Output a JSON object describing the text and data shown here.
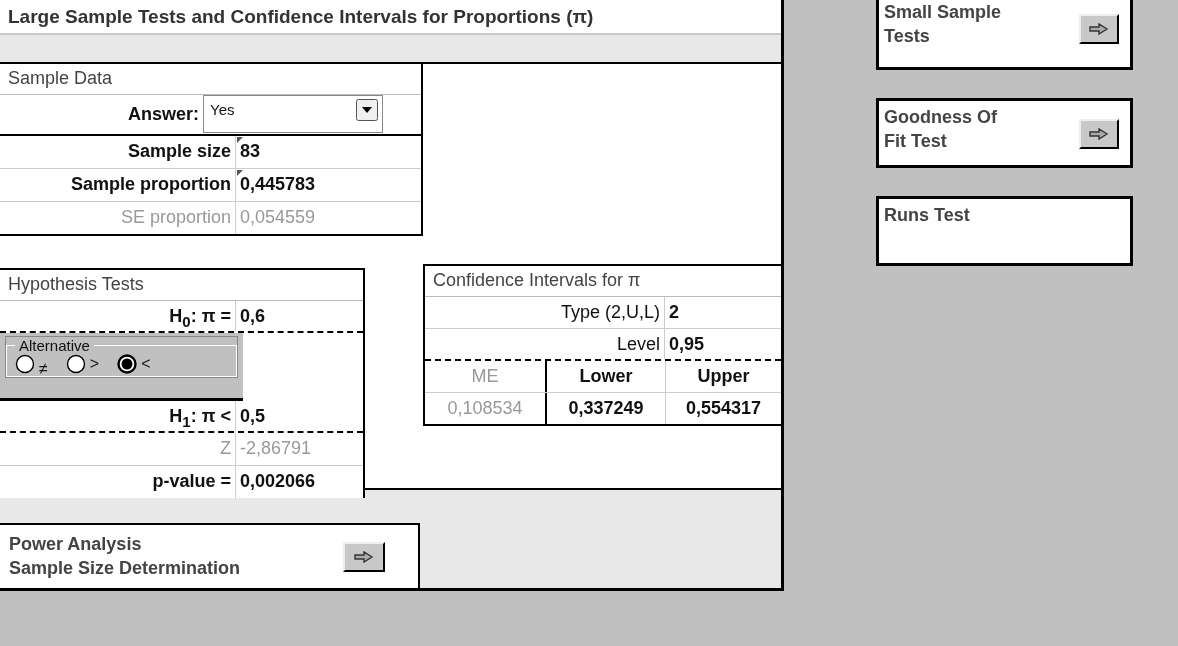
{
  "title": "Large Sample Tests and Confidence Intervals for Proportions (π)",
  "sample_data": {
    "heading": "Sample Data",
    "answer": {
      "label": "Answer:",
      "value": "Yes"
    },
    "rows": [
      {
        "label": "Sample size",
        "value": "83",
        "kind": "input"
      },
      {
        "label": "Sample proportion",
        "value": "0,445783",
        "kind": "input"
      },
      {
        "label": "SE proportion",
        "value": "0,054559",
        "kind": "computed"
      }
    ]
  },
  "hypothesis": {
    "heading": "Hypothesis Tests",
    "h0": {
      "label": "H$_{0}$: π =",
      "value": "0,6"
    },
    "alternative": {
      "legend": "Alternative",
      "options": [
        {
          "label": "≠",
          "selected": false
        },
        {
          "label": ">",
          "selected": false
        },
        {
          "label": "<",
          "selected": true
        }
      ]
    },
    "h1": {
      "label": "H$_{1}$: π <",
      "value": "0,5"
    },
    "z": {
      "label": "Z",
      "value": "-2,86791"
    },
    "p": {
      "label": "p-value =",
      "value": "0,002066"
    }
  },
  "ci": {
    "heading": "Confidence Intervals for π",
    "type": {
      "label": "Type (2,U,L)",
      "value": "2"
    },
    "level": {
      "label": "Level",
      "value": "0,95"
    },
    "columns": [
      {
        "label": "ME",
        "value": "0,108534",
        "kind": "computed"
      },
      {
        "label": "Lower",
        "value": "0,337249",
        "kind": "result"
      },
      {
        "label": "Upper",
        "value": "0,554317",
        "kind": "result"
      }
    ]
  },
  "power": {
    "label": "Power Analysis\nSample Size Determination",
    "button": true
  },
  "nav": [
    {
      "label": "Small Sample\nTests",
      "button": true
    },
    {
      "label": "Goodness Of\nFit Test",
      "button": true
    },
    {
      "label": "Runs Test",
      "button": false
    }
  ]
}
